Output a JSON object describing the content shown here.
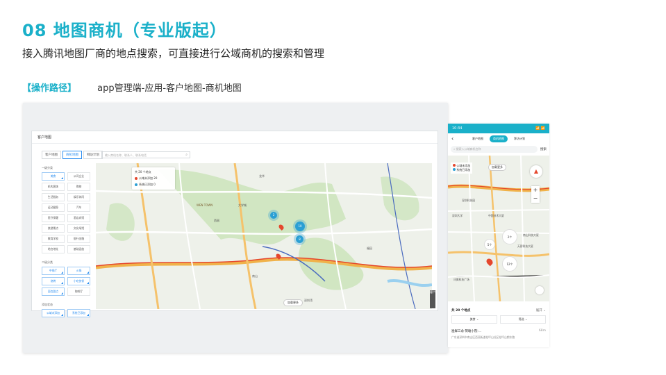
{
  "slide": {
    "title": "08  地图商机（专业版起）",
    "subtitle": "接入腾讯地图厂商的地点搜索，可直接进行公域商机的搜索和管理",
    "path_label": "【操作路径】",
    "path_value": "app管理端-应用-客户地图-商机地图",
    "accent": "#1ab0c9"
  },
  "desktop": {
    "page_title": "客户地图",
    "tabs": [
      "客户地图",
      "商机地图",
      "拜访计划"
    ],
    "active_tab": "商机地图",
    "search_placeholder": "输入商机名称、联系人、联系电话",
    "filter_groups": [
      {
        "title": "一级分类",
        "items": [
          {
            "label": "美食",
            "on": true
          },
          {
            "label": "公司企业",
            "on": false
          },
          {
            "label": "机构团体",
            "on": false
          },
          {
            "label": "购物",
            "on": false
          },
          {
            "label": "生活服务",
            "on": false
          },
          {
            "label": "娱乐休闲",
            "on": false
          },
          {
            "label": "运动健身",
            "on": false
          },
          {
            "label": "汽车",
            "on": false
          },
          {
            "label": "医疗保健",
            "on": false
          },
          {
            "label": "酒店宾馆",
            "on": false
          },
          {
            "label": "旅游景点",
            "on": false
          },
          {
            "label": "文化场馆",
            "on": false
          },
          {
            "label": "教育学校",
            "on": false
          },
          {
            "label": "银行金融",
            "on": false
          },
          {
            "label": "地名地址",
            "on": false
          },
          {
            "label": "基础设施",
            "on": false
          }
        ]
      },
      {
        "title": "二级分类",
        "items": [
          {
            "label": "中餐厅",
            "on": true
          },
          {
            "label": "火锅",
            "on": true
          },
          {
            "label": "烧烤",
            "on": true
          },
          {
            "label": "小吃快餐",
            "on": true
          },
          {
            "label": "面包甜点",
            "on": true
          },
          {
            "label": "咖啡厅",
            "on": false
          }
        ]
      },
      {
        "title": "添加状态",
        "items": [
          {
            "label": "公域未添加",
            "on": true
          },
          {
            "label": "系统已添加",
            "on": true
          }
        ]
      }
    ],
    "legend": {
      "title": "共 20 个地点",
      "rows": [
        {
          "label": "公域未添加 20",
          "color": "#e5472d"
        },
        {
          "label": "系统已添加 0",
          "color": "#2b9fd4"
        }
      ]
    },
    "clusters": [
      "2",
      "10",
      "8"
    ],
    "load_more": "加载更多",
    "map_labels": [
      "WEN TOWN",
      "大学城",
      "龙华",
      "南山",
      "西丽",
      "深圳湾",
      "福田"
    ],
    "side_tab": "客户"
  },
  "phone": {
    "time": "10:34",
    "status_icons": "📶 📶",
    "tabs": [
      "客户地图",
      "商机地图",
      "拜访计划"
    ],
    "active_tab": "商机地图",
    "search_placeholder": "搜索入公域商机名称",
    "search_button": "搜索",
    "legend_rows": [
      {
        "label": "公域未添加",
        "color": "#e5472d"
      },
      {
        "label": "系统已添加",
        "color": "#2b9fd4"
      }
    ],
    "load_more": "加载更多",
    "clusters": [
      "2个",
      "5个",
      "12个"
    ],
    "map_labels": [
      "深圳大学",
      "中国技术大厦",
      "深圳科技园",
      "天骄科技大厦",
      "南山科技大厦",
      "讯美科技广场"
    ],
    "list_count": "共 20 个地点",
    "expand": "展开",
    "filter_a": "美食",
    "filter_b": "筛选",
    "item_title": "渔鲜三氽·荷塘小院·...",
    "item_distance": "68m",
    "item_address": "广东省深圳市南山区西丽街道松坪山社区松坪山朗东路"
  }
}
